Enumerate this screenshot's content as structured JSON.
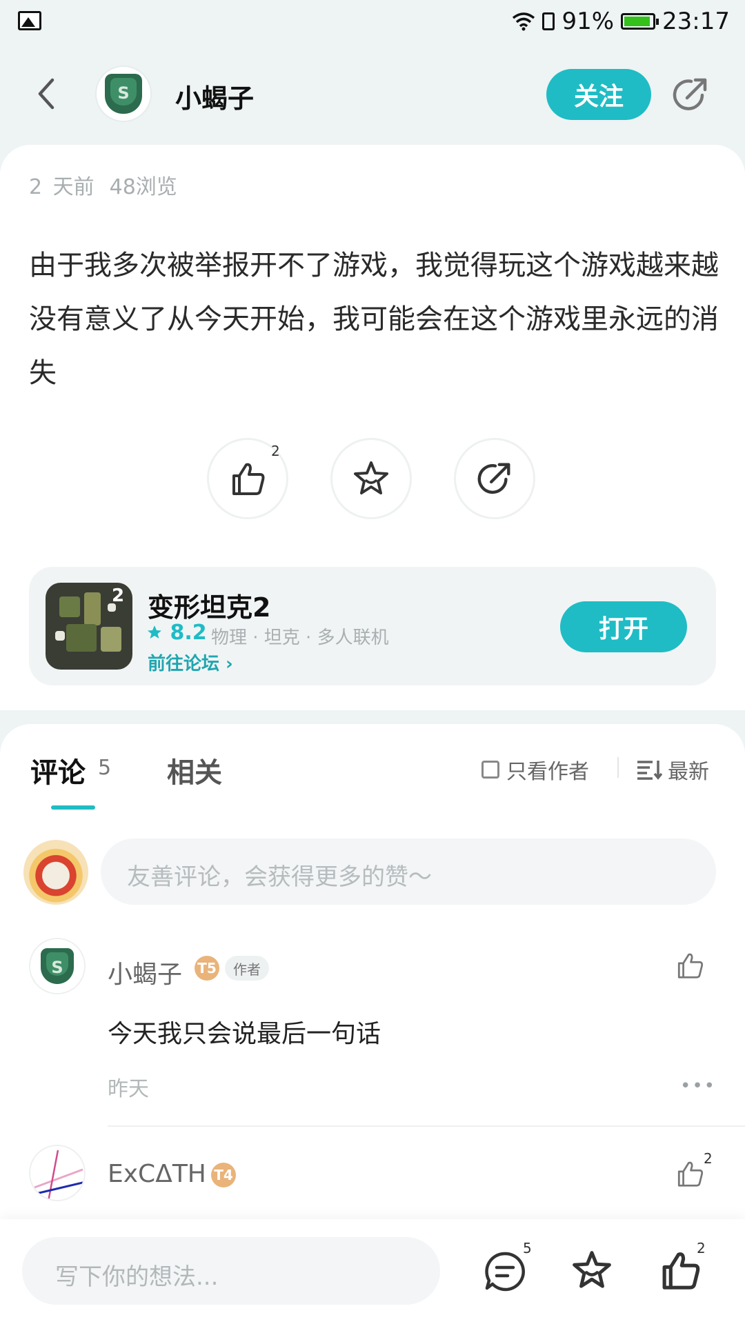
{
  "status_bar": {
    "battery": "91%",
    "time": "23:17"
  },
  "header": {
    "username": "小蝎子",
    "follow_label": "关注"
  },
  "post": {
    "time_ago": "2 天前",
    "views": "48浏览",
    "content": "由于我多次被举报开不了游戏，我觉得玩这个游戏越来越没有意义了从今天开始，我可能会在这个游戏里永远的消失",
    "like_count": "2"
  },
  "game": {
    "title": "变形坦克2",
    "rating": "8.2",
    "tags": "物理 · 坦克 · 多人联机",
    "forum_link": "前往论坛 ›",
    "open_label": "打开"
  },
  "comments_section": {
    "tab_comments": "评论",
    "comment_count": "5",
    "tab_related": "相关",
    "only_author": "只看作者",
    "sort": "最新",
    "input_placeholder": "友善评论，会获得更多的赞～"
  },
  "comments": [
    {
      "name": "小蝎子",
      "level": "T5",
      "badge": "作者",
      "text": "今天我只会说最后一句话",
      "time": "昨天"
    },
    {
      "name": "ExCΔTH",
      "level": "T4",
      "like_count": "2"
    }
  ],
  "bottom_bar": {
    "placeholder": "写下你的想法...",
    "comment_count": "5",
    "like_count": "2"
  },
  "colors": {
    "accent": "#1fbcc5",
    "background": "#eef3f4"
  }
}
